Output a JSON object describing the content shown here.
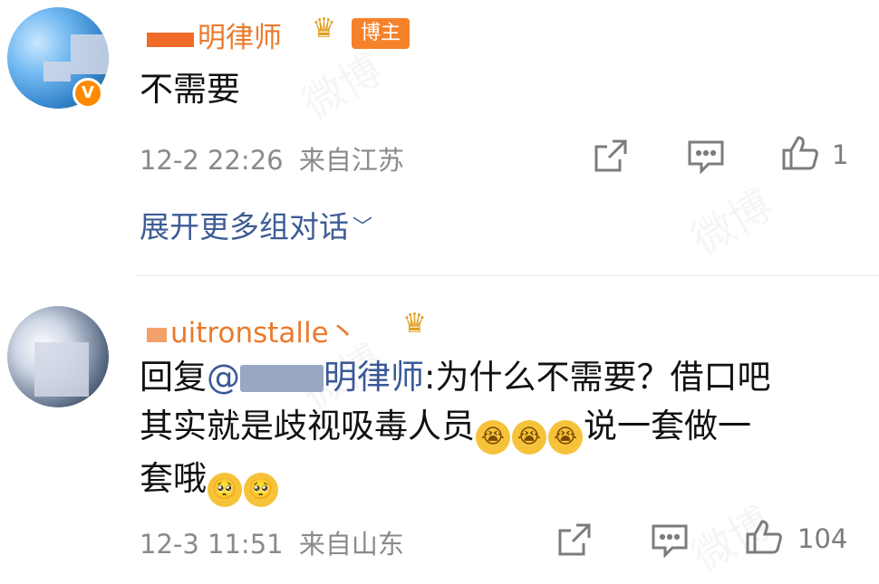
{
  "comments": [
    {
      "username_suffix": "明律师",
      "badge": "博主",
      "verified": "V",
      "text": "不需要",
      "time": "12-2 22:26",
      "location": "来自江苏",
      "like_count": "1",
      "expand_label": "展开更多组对话"
    },
    {
      "username_suffix": "uitronstalle丶",
      "reply_prefix": "回复",
      "mention": "@",
      "mention_suffix": "明律师",
      "line1_rest": ":为什么不需要？借口吧",
      "line2_before": "其实就是歧视吸毒人员",
      "line2_after": "说一套做一",
      "line3": "套哦",
      "time": "12-3 11:51",
      "location": "来自山东",
      "like_count": "104"
    }
  ],
  "watermark": "微博",
  "icons": [
    "share-icon",
    "comment-icon",
    "like-icon",
    "crown-icon",
    "crying-emoji",
    "shy-emoji",
    "chevron-down-icon"
  ]
}
